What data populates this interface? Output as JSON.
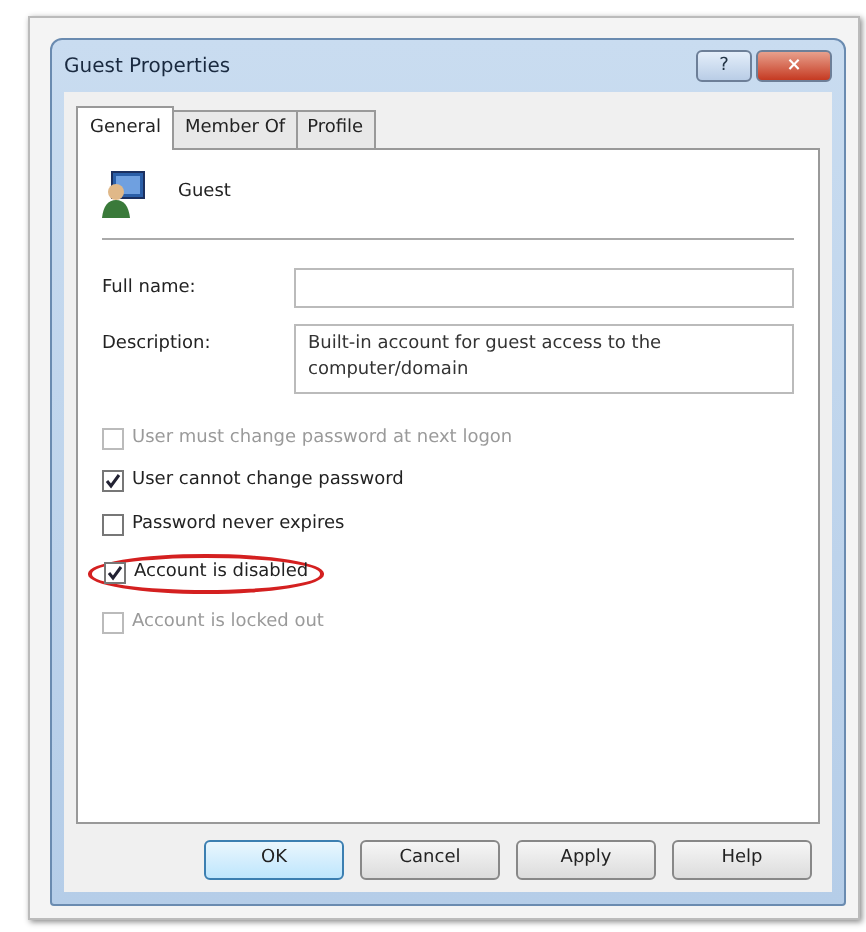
{
  "window": {
    "title": "Guest Properties",
    "help_button": "?",
    "close_button": "×"
  },
  "tabs": [
    {
      "label": "General",
      "selected": true
    },
    {
      "label": "Member Of",
      "selected": false
    },
    {
      "label": "Profile",
      "selected": false
    }
  ],
  "user": {
    "name": "Guest"
  },
  "fields": [
    {
      "label": "Full name:"
    },
    {
      "label": "Description:",
      "value": "Built-in account for guest access to the computer/domain"
    }
  ],
  "checkboxes": [
    {
      "label": "User must change password at next logon",
      "checked": false,
      "disabled": true,
      "highlighted": false
    },
    {
      "label": "User cannot change password",
      "checked": true,
      "disabled": false,
      "highlighted": false
    },
    {
      "label": "Password never expires",
      "checked": false,
      "disabled": false,
      "highlighted": false
    },
    {
      "label": "Account is disabled",
      "checked": true,
      "disabled": false,
      "highlighted": true
    },
    {
      "label": "Account is locked out",
      "checked": false,
      "disabled": true,
      "highlighted": false
    }
  ],
  "buttons": [
    {
      "label": "OK",
      "default": true
    },
    {
      "label": "Cancel",
      "default": false
    },
    {
      "label": "Apply",
      "default": false
    },
    {
      "label": "Help",
      "default": false
    }
  ]
}
